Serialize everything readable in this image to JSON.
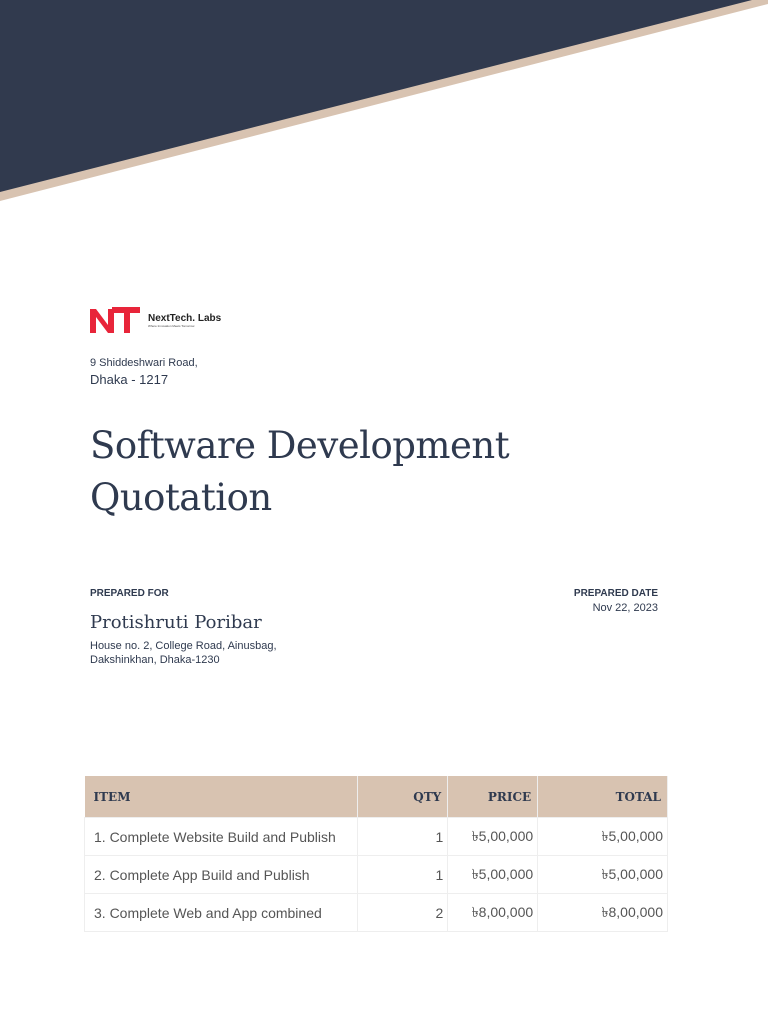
{
  "logo": {
    "mark": "NT",
    "name": "NextTech. Labs",
    "tagline": "Where Innovation Meets Tomorrow"
  },
  "company_address": {
    "line1": "9 Shiddeshwari Road,",
    "line2": "Dhaka - 1217"
  },
  "title": {
    "line1": "Software Development",
    "line2": "Quotation"
  },
  "prepared_for": {
    "label": "PREPARED FOR",
    "name": "Protishruti Poribar",
    "address_line1": "House no. 2, College Road, Ainusbag,",
    "address_line2": "Dakshinkhan, Dhaka-1230"
  },
  "prepared_date": {
    "label": "PREPARED DATE",
    "value": "Nov 22, 2023"
  },
  "table": {
    "headers": [
      "ITEM",
      "QTY",
      "PRICE",
      "TOTAL"
    ],
    "rows": [
      [
        "1. Complete Website Build and Publish",
        "1",
        "৳5,00,000",
        "৳5,00,000"
      ],
      [
        "2. Complete App Build and Publish",
        "1",
        "৳5,00,000",
        "৳5,00,000"
      ],
      [
        "3. Complete Web and App combined",
        "2",
        "৳8,00,000",
        "৳8,00,000"
      ]
    ]
  },
  "colors": {
    "navy": "#313a4e",
    "tan": "#d8c3b1",
    "logo_red": "#e8253a"
  }
}
